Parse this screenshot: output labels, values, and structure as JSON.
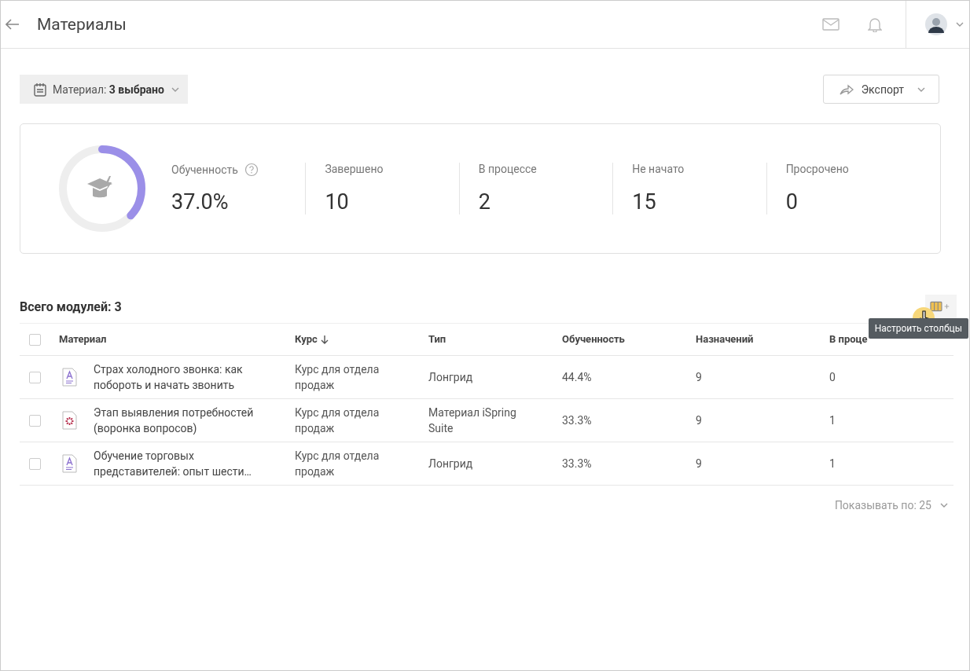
{
  "header": {
    "title": "Материалы"
  },
  "filter": {
    "label": "Материал: ",
    "value": "3 выбрано"
  },
  "export_button": {
    "label": "Экспорт"
  },
  "summary": {
    "level": 0.37,
    "stats": [
      {
        "label": "Обученность",
        "value": "37.0%",
        "help": true
      },
      {
        "label": "Завершено",
        "value": "10",
        "help": false
      },
      {
        "label": "В процессе",
        "value": "2",
        "help": false
      },
      {
        "label": "Не начато",
        "value": "15",
        "help": false
      },
      {
        "label": "Просрочено",
        "value": "0",
        "help": false
      }
    ]
  },
  "table": {
    "total": "Всего модулей: 3",
    "tooltip": "Настроить столбцы",
    "select_all_checked": false,
    "columns": [
      {
        "label": "Материал",
        "sorted": false
      },
      {
        "label": "Курс",
        "sorted": true
      },
      {
        "label": "Тип",
        "sorted": false
      },
      {
        "label": "Обученность",
        "sorted": false
      },
      {
        "label": "Назначений",
        "sorted": false
      },
      {
        "label": "В проце",
        "sorted": false
      }
    ],
    "rows": [
      {
        "checked": false,
        "kind": "longread",
        "material": "Страх холодного звонка: как побороть и начать звонить",
        "course": "Курс для отдела продаж",
        "type": "Лонгрид",
        "progress": "44.4%",
        "assigned": "9",
        "in_progress": "0"
      },
      {
        "checked": false,
        "kind": "ispring",
        "material": "Этап выявления потребностей (воронка вопросов)",
        "course": "Курс для отдела продаж",
        "type": "Материал iSpring Suite",
        "progress": "33.3%",
        "assigned": "9",
        "in_progress": "1"
      },
      {
        "checked": false,
        "kind": "longread",
        "material": "Обучение торговых представителей: опыт шести…",
        "course": "Курс для отдела продаж",
        "type": "Лонгрид",
        "progress": "33.3%",
        "assigned": "9",
        "in_progress": "1"
      }
    ]
  },
  "pagination": {
    "label": "Показывать по: 25"
  }
}
